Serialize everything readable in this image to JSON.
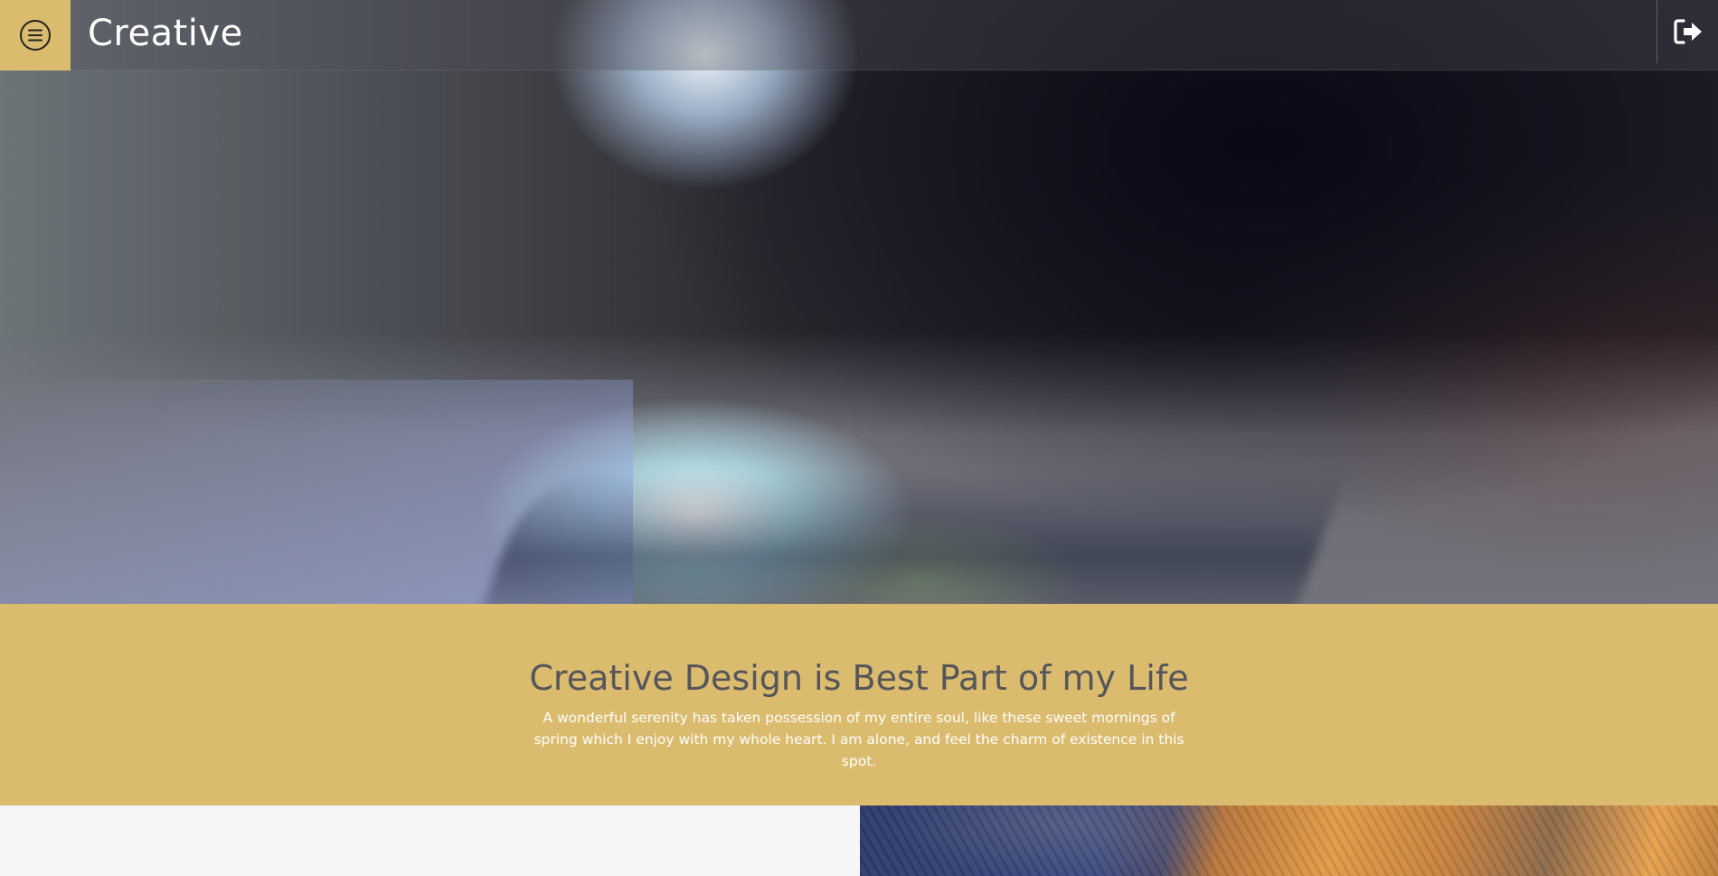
{
  "header": {
    "brand": "Creative",
    "menu_icon": "hamburger-circle-icon",
    "logout_icon": "sign-out-icon"
  },
  "hero": {
    "image": "blurred-smartphone-photo"
  },
  "banner": {
    "title": "Creative Design is Best Part of my Life",
    "text": "A wonderful serenity has taken possession of my entire soul, like these sweet mornings of spring which I enjoy with my whole heart. I am alone, and feel the charm of existence in this spot."
  },
  "colors": {
    "accent": "#dbbb6e",
    "title_text": "#55565a",
    "body_text": "#ffffff",
    "panel_light": "#f6f6f8"
  }
}
